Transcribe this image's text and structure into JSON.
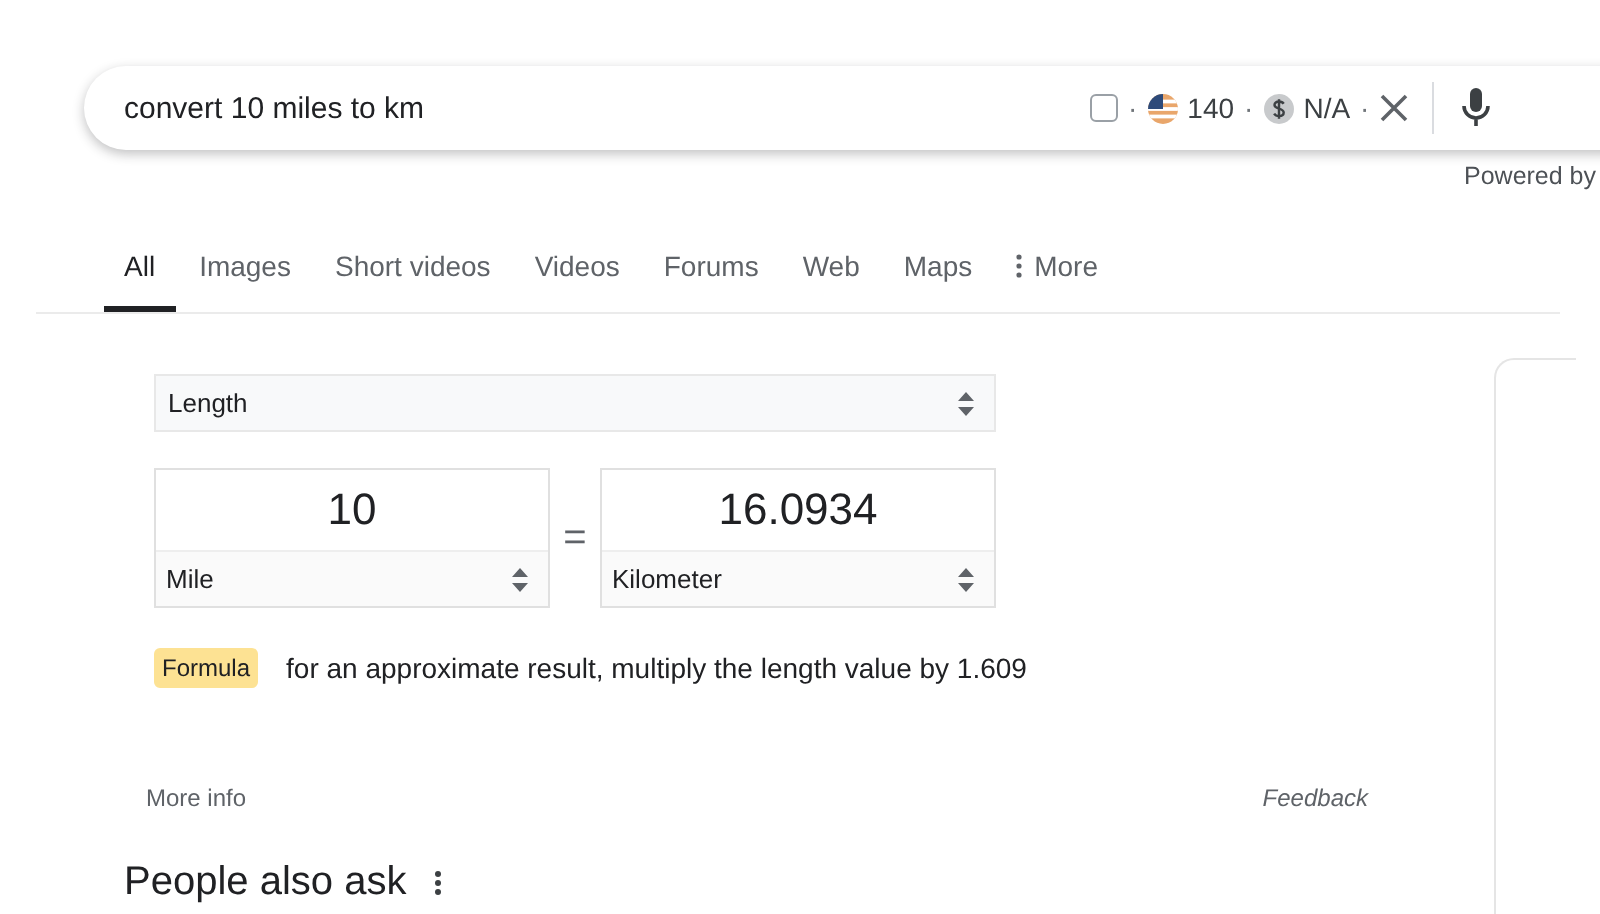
{
  "search": {
    "query": "convert 10 miles to km",
    "checkbox": {
      "checked": false
    },
    "count": "140",
    "price": "N/A",
    "separator": "·"
  },
  "powered_by": "Powered by",
  "tabs": [
    {
      "label": "All",
      "selected": true
    },
    {
      "label": "Images",
      "selected": false
    },
    {
      "label": "Short videos",
      "selected": false
    },
    {
      "label": "Videos",
      "selected": false
    },
    {
      "label": "Forums",
      "selected": false
    },
    {
      "label": "Web",
      "selected": false
    },
    {
      "label": "Maps",
      "selected": false
    },
    {
      "label": "More",
      "selected": false,
      "kind": "menu"
    }
  ],
  "converter": {
    "quantity": "Length",
    "from_value": "10",
    "equals": "=",
    "to_value": "16.0934",
    "from_unit": "Mile",
    "to_unit": "Kilometer",
    "formula_badge": "Formula",
    "formula": "for an approximate result, multiply the length value by 1.609"
  },
  "more_info": "More info",
  "feedback": "Feedback",
  "people_also_ask": "People also ask"
}
